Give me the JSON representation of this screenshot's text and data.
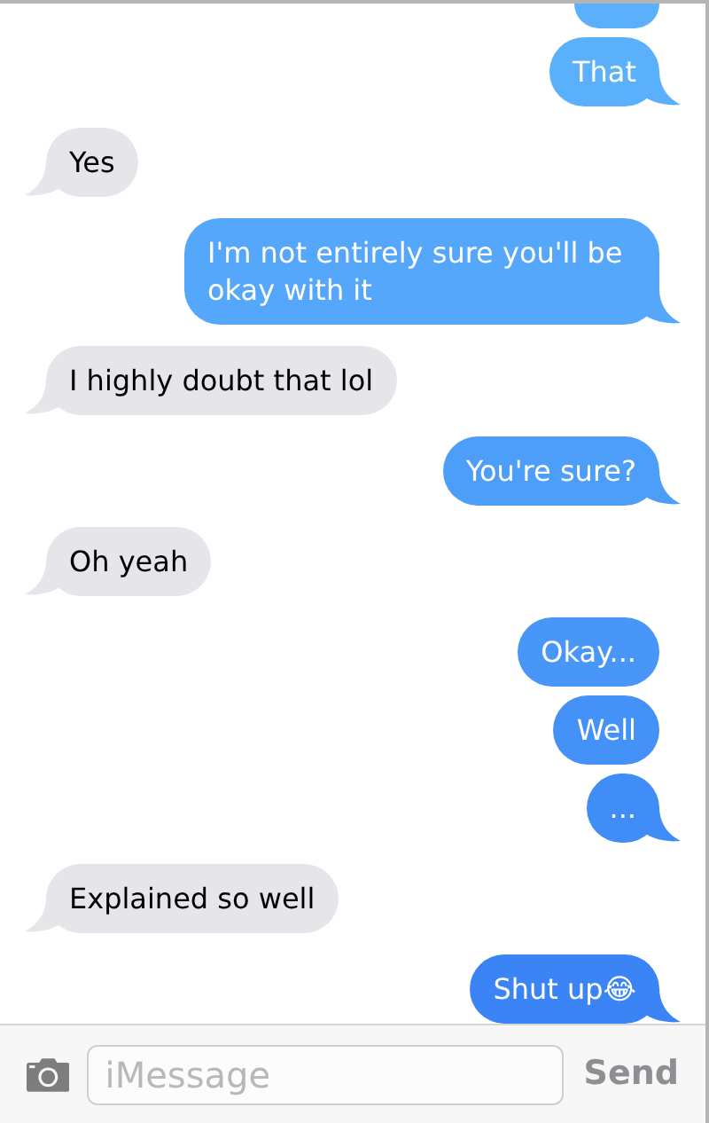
{
  "messages": [
    {
      "kind": "sent",
      "text": "That",
      "tail": true
    },
    {
      "kind": "received",
      "text": "Yes",
      "tail": true
    },
    {
      "kind": "sent",
      "text": "I'm not entirely sure you'll be okay with it",
      "tail": true
    },
    {
      "kind": "received",
      "text": "I highly doubt that lol",
      "tail": true
    },
    {
      "kind": "sent",
      "text": "You're sure?",
      "tail": true
    },
    {
      "kind": "received",
      "text": "Oh yeah",
      "tail": true
    },
    {
      "kind": "sent",
      "text": "Okay...",
      "tail": false
    },
    {
      "kind": "sent",
      "text": "Well",
      "tail": false
    },
    {
      "kind": "sent",
      "text": "...",
      "tail": true
    },
    {
      "kind": "received",
      "text": "Explained so well",
      "tail": true
    },
    {
      "kind": "sent",
      "text": "Shut up😂",
      "tail": true
    }
  ],
  "composer": {
    "placeholder": "iMessage",
    "send": "Send"
  }
}
